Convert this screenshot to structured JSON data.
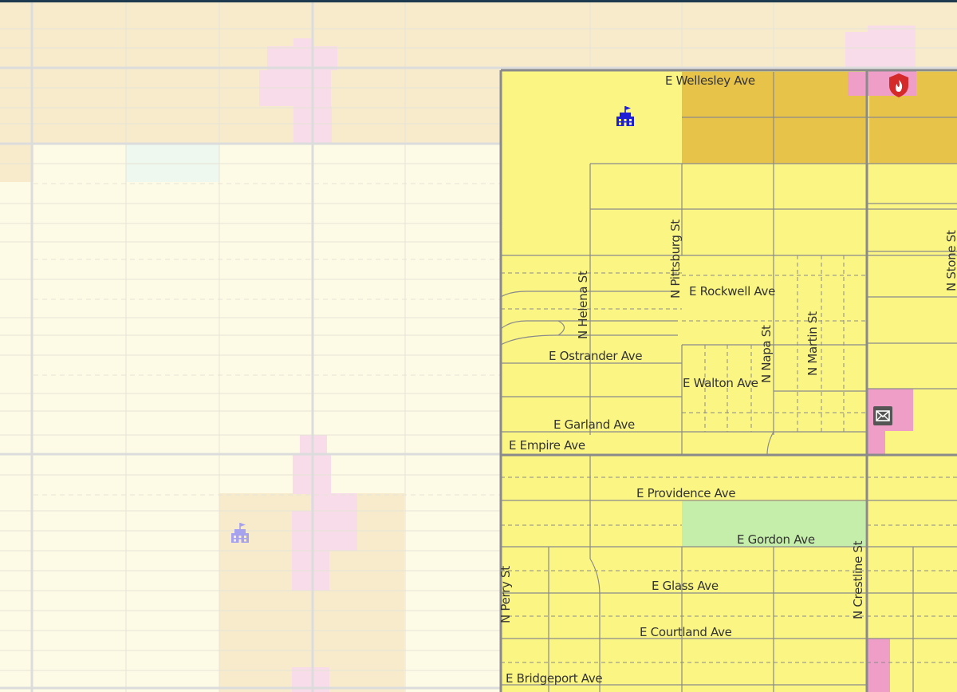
{
  "map": {
    "streets": {
      "wellesley": "E Wellesley Ave",
      "rockwell": "E Rockwell Ave",
      "ostrander": "E Ostrander Ave",
      "walton": "E Walton Ave",
      "garland": "E Garland Ave",
      "empire": "E Empire Ave",
      "providence": "E Providence Ave",
      "gordon": "E Gordon Ave",
      "glass": "E Glass Ave",
      "courtland": "E Courtland Ave",
      "bridgeport": "E Bridgeport Ave",
      "helena": "N Helena St",
      "pittsburg": "N Pittsburg St",
      "napa": "N Napa St",
      "martin": "N Martin St",
      "stone": "N Stone St",
      "perry": "N Perry St",
      "crestline": "N Crestline St"
    },
    "icons": {
      "school_active": "school-icon",
      "school_faded": "school-icon",
      "fire_station": "fire-station-icon",
      "post_office": "post-office-icon"
    },
    "colors": {
      "residential": "#fbf684",
      "commercial": "#e8c34a",
      "mixed_use": "#ef9ec8",
      "park": "#c5eeaa",
      "faded_residential": "#fdfbe6",
      "faded_commercial": "#f7ebcc",
      "faded_mixed": "#f8dcea",
      "school_icon": "#1f1fd6",
      "fire_icon": "#d42a2a"
    }
  }
}
